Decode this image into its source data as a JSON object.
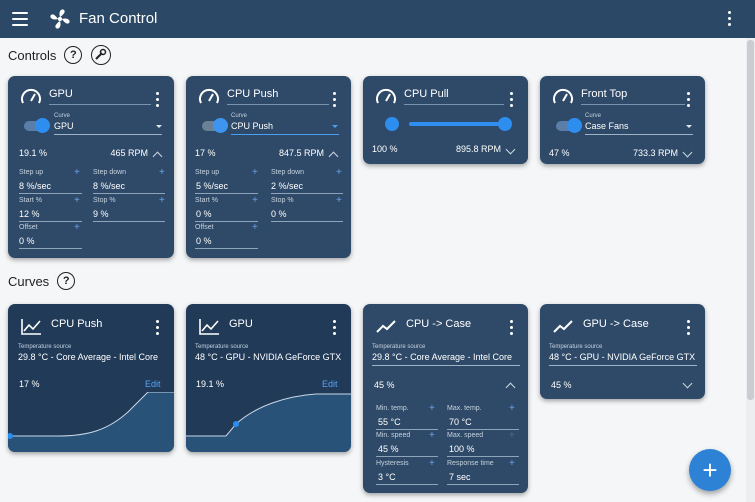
{
  "app": {
    "title": "Fan Control"
  },
  "sections": {
    "controls": "Controls",
    "curves": "Curves"
  },
  "controls": [
    {
      "name": "GPU",
      "selector_label": "Curve",
      "selector_value": "GPU",
      "percent": "19.1 %",
      "rpm": "465 RPM",
      "fields": [
        {
          "label": "Step up",
          "value": "8 %/sec"
        },
        {
          "label": "Step down",
          "value": "8 %/sec"
        },
        {
          "label": "Start %",
          "value": "12 %"
        },
        {
          "label": "Stop %",
          "value": "9 %"
        },
        {
          "label": "Offset",
          "value": "0 %"
        }
      ]
    },
    {
      "name": "CPU Push",
      "selector_label": "Curve",
      "selector_value": "CPU Push",
      "percent": "17 %",
      "rpm": "847.5 RPM",
      "fields": [
        {
          "label": "Step up",
          "value": "5 %/sec"
        },
        {
          "label": "Step down",
          "value": "2 %/sec"
        },
        {
          "label": "Start %",
          "value": "0 %"
        },
        {
          "label": "Stop %",
          "value": "0 %"
        },
        {
          "label": "Offset",
          "value": "0 %"
        }
      ]
    },
    {
      "name": "CPU Pull",
      "percent": "100 %",
      "rpm": "895.8 RPM",
      "slider_value": 1.0
    },
    {
      "name": "Front Top",
      "selector_label": "Curve",
      "selector_value": "Case Fans",
      "percent": "47 %",
      "rpm": "733.3 RPM"
    }
  ],
  "curves": [
    {
      "name": "CPU Push",
      "source_label": "Temperature source",
      "source_value": "29.8 °C - Core Average - Intel Core",
      "percent": "17 %",
      "edit": "Edit"
    },
    {
      "name": "GPU",
      "source_label": "Temperature source",
      "source_value": "48 °C - GPU - NVIDIA GeForce GTX",
      "percent": "19.1 %",
      "edit": "Edit"
    },
    {
      "name": "CPU -> Case",
      "source_label": "Temperature source",
      "source_value": "29.8 °C - Core Average - Intel Core",
      "percent": "45 %",
      "fields": [
        {
          "label": "Min. temp.",
          "value": "55 °C"
        },
        {
          "label": "Max. temp.",
          "value": "70 °C"
        },
        {
          "label": "Min. speed",
          "value": "45 %"
        },
        {
          "label": "Max. speed",
          "value": "100 %"
        },
        {
          "label": "Hysteresis",
          "value": "3 °C"
        },
        {
          "label": "Response time",
          "value": "7 sec"
        }
      ]
    },
    {
      "name": "GPU -> Case",
      "source_label": "Temperature source",
      "source_value": "48 °C - GPU - NVIDIA GeForce GTX",
      "percent": "45 %"
    }
  ],
  "fab": {
    "label": "+"
  },
  "colors": {
    "appbar": "#2b4867",
    "card": "#2f4a68",
    "accent": "#2d8ef0"
  }
}
